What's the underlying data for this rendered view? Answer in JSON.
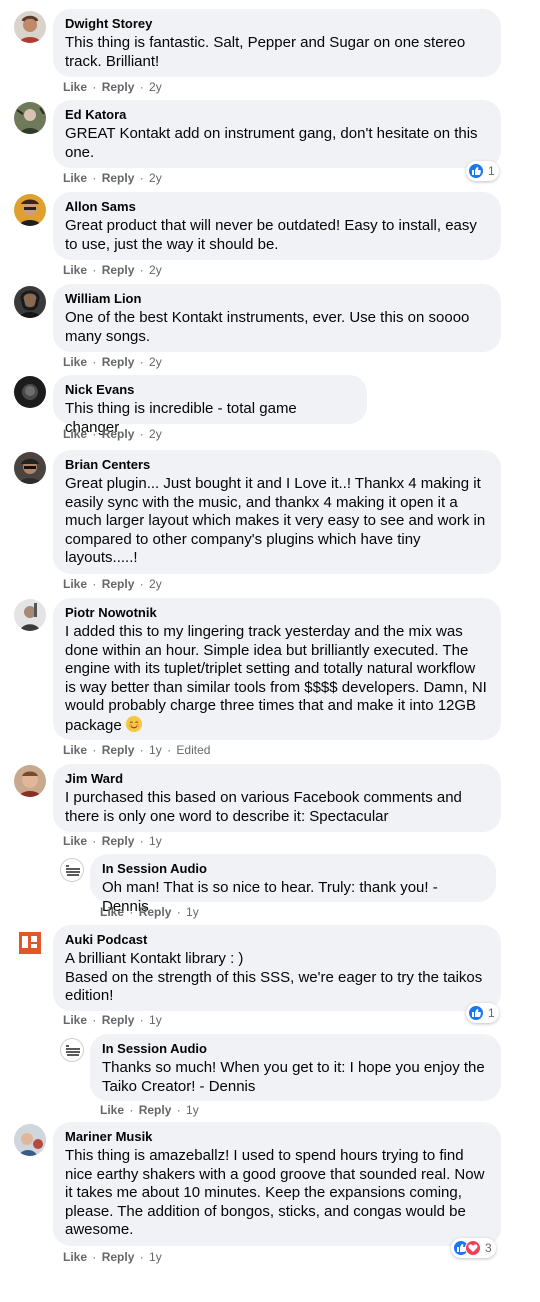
{
  "actions": {
    "like": "Like",
    "reply": "Reply"
  },
  "comments": [
    {
      "name": "Dwight Storey",
      "text": "This thing is fantastic. Salt, Pepper and Sugar on one stereo\ntrack. Brilliant!",
      "time": "2y"
    },
    {
      "name": "Ed Katora",
      "text": "GREAT Kontakt add on instrument gang, don't hesitate on this\none.",
      "time": "2y",
      "reactions": "1"
    },
    {
      "name": "Allon Sams",
      "text": "Great product that will never be outdated! Easy to install, easy\nto use, just the way it should be.",
      "time": "2y"
    },
    {
      "name": "William Lion",
      "text": "One of the best Kontakt instruments, ever. Use this on soooo\nmany songs.",
      "time": "2y"
    },
    {
      "name": "Nick Evans",
      "text": "This thing is incredible - total game changer",
      "time": "2y"
    },
    {
      "name": "Brian Centers",
      "text": "Great plugin... Just bought it and I Love it..! Thankx 4 making it\neasily sync with the music, and thankx 4 making it open it a\nmuch larger layout which makes it very easy to see and work in\ncompared to other company's plugins which have tiny\nlayouts.....!",
      "time": "2y"
    },
    {
      "name": "Piotr Nowotnik",
      "text": "I added this to my lingering track yesterday and the mix was\ndone within an hour. Simple idea but brilliantly executed. The\nengine with its tuplet/triplet setting and totally natural workflow\nis way better than similar tools from $$$$ developers. Damn, NI\nwould probably charge three times that and make it into 12GB\npackage",
      "time": "1y",
      "edited": "Edited"
    },
    {
      "name": "Jim Ward",
      "text": "I purchased this based on various Facebook comments and\nthere is only one word to describe it: Spectacular",
      "time": "1y"
    },
    {
      "name": "Auki Podcast",
      "text": "A brilliant Kontakt library : )\nBased on the strength of this SSS, we're eager to try the taikos\nedition!",
      "time": "1y",
      "reactions": "1"
    },
    {
      "name": "Mariner Musik",
      "text": "This thing is amazeballz! I used to spend hours trying to find\nnice earthy shakers with a good groove that sounded real. Now\nit takes me about 10 minutes. Keep the expansions coming,\nplease. The addition of bongos, sticks, and congas would be\nawesome.",
      "time": "1y",
      "reactions": "3"
    }
  ],
  "replies": [
    {
      "name": "In Session Audio",
      "text": "Oh man! That is so nice to hear. Truly: thank you! - Dennis",
      "time": "1y"
    },
    {
      "name": "In Session Audio",
      "text": "Thanks so much! When you get to it: I hope you enjoy the\nTaiko Creator! - Dennis",
      "time": "1y"
    }
  ],
  "colors": {
    "like": "#1877f2",
    "love": "#f33e58",
    "bubble": "#f0f2f5",
    "meta": "#65676b"
  },
  "icons": {
    "like": "thumbs-up-icon",
    "love": "heart-icon",
    "emoji": "blushing-smile-emoji"
  }
}
